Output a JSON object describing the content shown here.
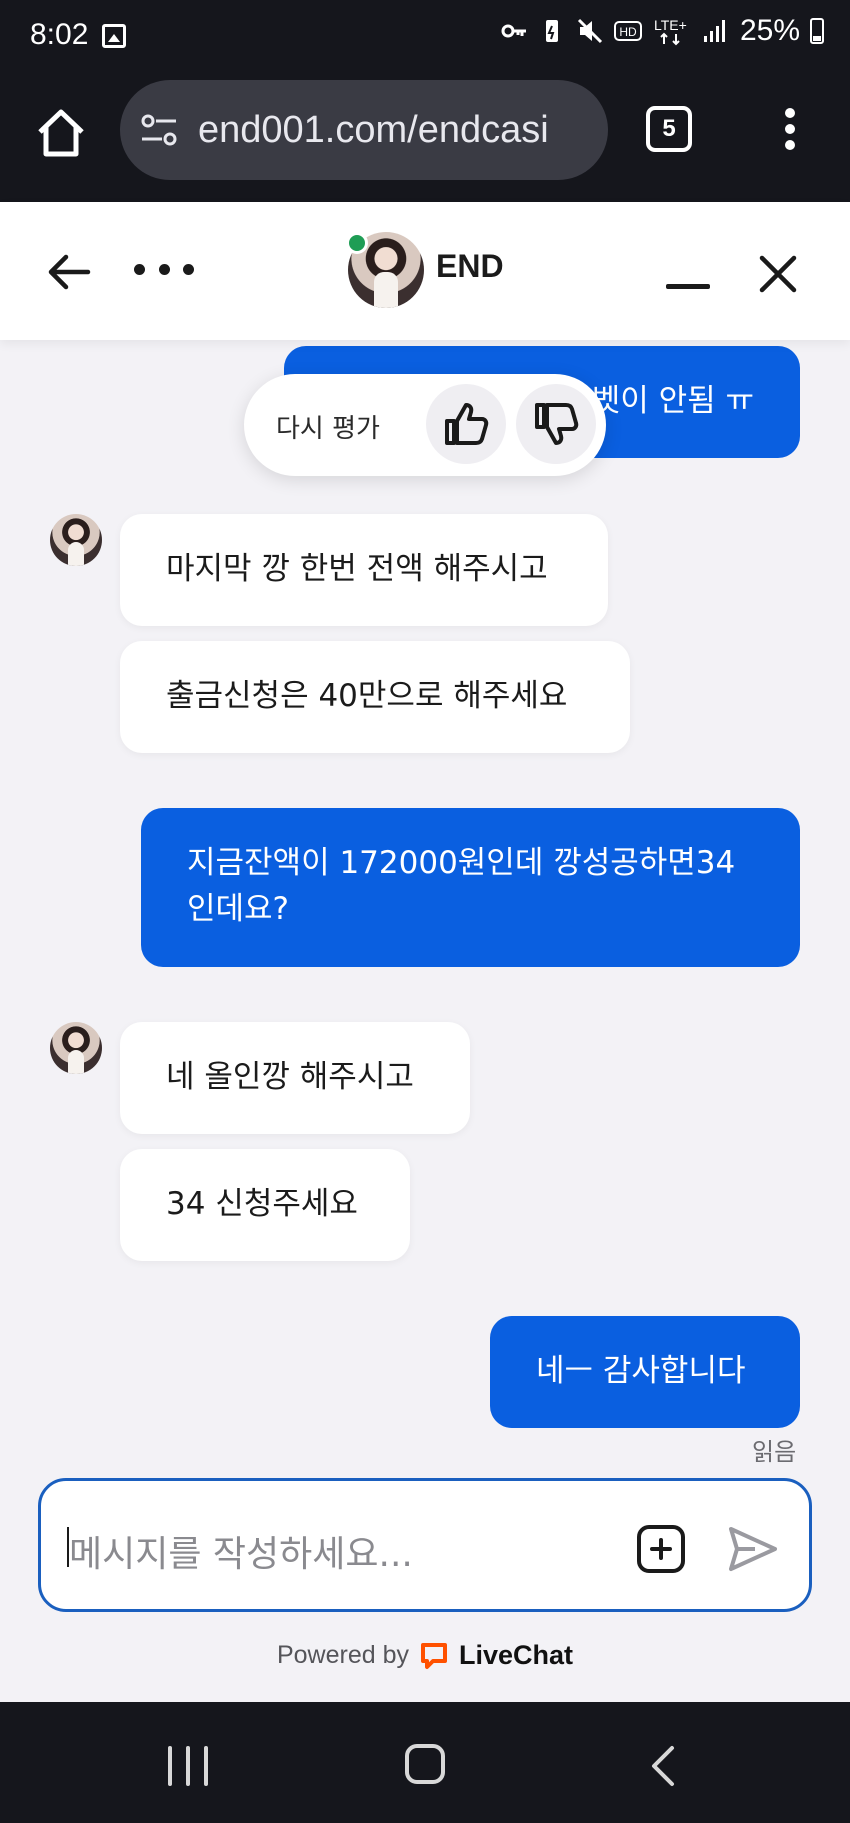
{
  "status_bar": {
    "time": "8:02",
    "network": "LTE+",
    "hd": "HD",
    "battery_percent": "25%"
  },
  "browser": {
    "url": "end001.com/endcasi",
    "tab_count": "5"
  },
  "chat_header": {
    "agent_name": "END"
  },
  "rating": {
    "label": "다시 평가"
  },
  "messages": [
    {
      "direction": "out",
      "text": "벳이 안됨 ㅠ"
    },
    {
      "direction": "in",
      "text": "마지막 깡 한번 전액 해주시고"
    },
    {
      "direction": "in",
      "text": "출금신청은 40만으로 해주세요"
    },
    {
      "direction": "out",
      "line1": "지금잔액이 172000원인데 깡성공하면34",
      "line2": "인데요?"
    },
    {
      "direction": "in",
      "text": "네 올인깡 해주시고"
    },
    {
      "direction": "in",
      "text": "34 신청주세요"
    },
    {
      "direction": "out",
      "text": "네ㅡ 감사합니다"
    }
  ],
  "read_status": "읽음",
  "composer": {
    "placeholder": "메시지를 작성하세요..."
  },
  "footer": {
    "powered_by": "Powered by",
    "brand": "LiveChat",
    "brand_color": "#ff5100"
  },
  "colors": {
    "outgoing_bubble": "#0a5fe0",
    "incoming_bubble": "#ffffff",
    "background": "#f3f2f6",
    "online": "#1f9d55"
  }
}
